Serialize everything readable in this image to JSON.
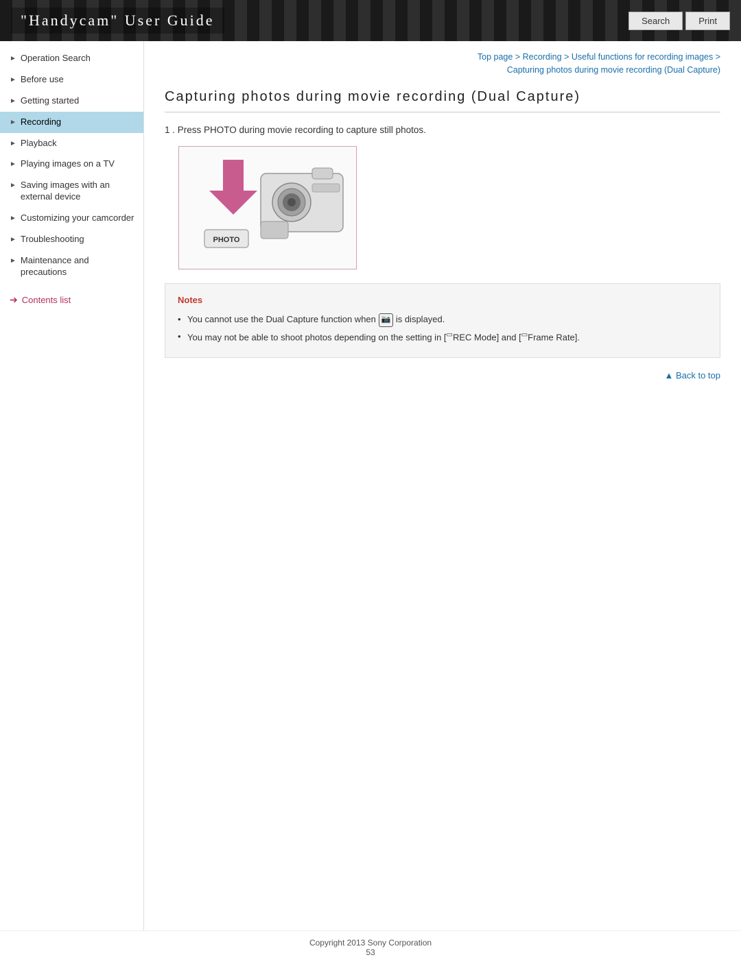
{
  "header": {
    "title": "\"Handycam\" User Guide",
    "search_label": "Search",
    "print_label": "Print"
  },
  "sidebar": {
    "items": [
      {
        "id": "operation-search",
        "label": "Operation Search",
        "active": false
      },
      {
        "id": "before-use",
        "label": "Before use",
        "active": false
      },
      {
        "id": "getting-started",
        "label": "Getting started",
        "active": false
      },
      {
        "id": "recording",
        "label": "Recording",
        "active": true
      },
      {
        "id": "playback",
        "label": "Playback",
        "active": false
      },
      {
        "id": "playing-images-tv",
        "label": "Playing images on a TV",
        "active": false
      },
      {
        "id": "saving-images",
        "label": "Saving images with an external device",
        "active": false
      },
      {
        "id": "customizing",
        "label": "Customizing your camcorder",
        "active": false
      },
      {
        "id": "troubleshooting",
        "label": "Troubleshooting",
        "active": false
      },
      {
        "id": "maintenance",
        "label": "Maintenance and precautions",
        "active": false
      }
    ],
    "contents_link": "Contents list"
  },
  "breadcrumb": {
    "parts": [
      {
        "text": "Top page",
        "link": true
      },
      {
        "text": " > ",
        "link": false
      },
      {
        "text": "Recording",
        "link": true
      },
      {
        "text": " > ",
        "link": false
      },
      {
        "text": "Useful functions for recording images",
        "link": true
      },
      {
        "text": " > ",
        "link": false
      },
      {
        "text": "Capturing photos during movie recording (Dual Capture)",
        "link": true
      }
    ]
  },
  "main": {
    "page_title": "Capturing photos during movie recording (Dual Capture)",
    "step1": "1 .  Press PHOTO during movie recording to capture still photos.",
    "notes": {
      "title": "Notes",
      "items": [
        "You cannot use the Dual Capture function when  is displayed.",
        "You may not be able to shoot photos depending on the setting in [ⓣREC Mode] and [ⓣFrame Rate]."
      ]
    },
    "back_to_top": "▲ Back to top"
  },
  "footer": {
    "copyright": "Copyright 2013 Sony Corporation",
    "page_number": "53"
  }
}
